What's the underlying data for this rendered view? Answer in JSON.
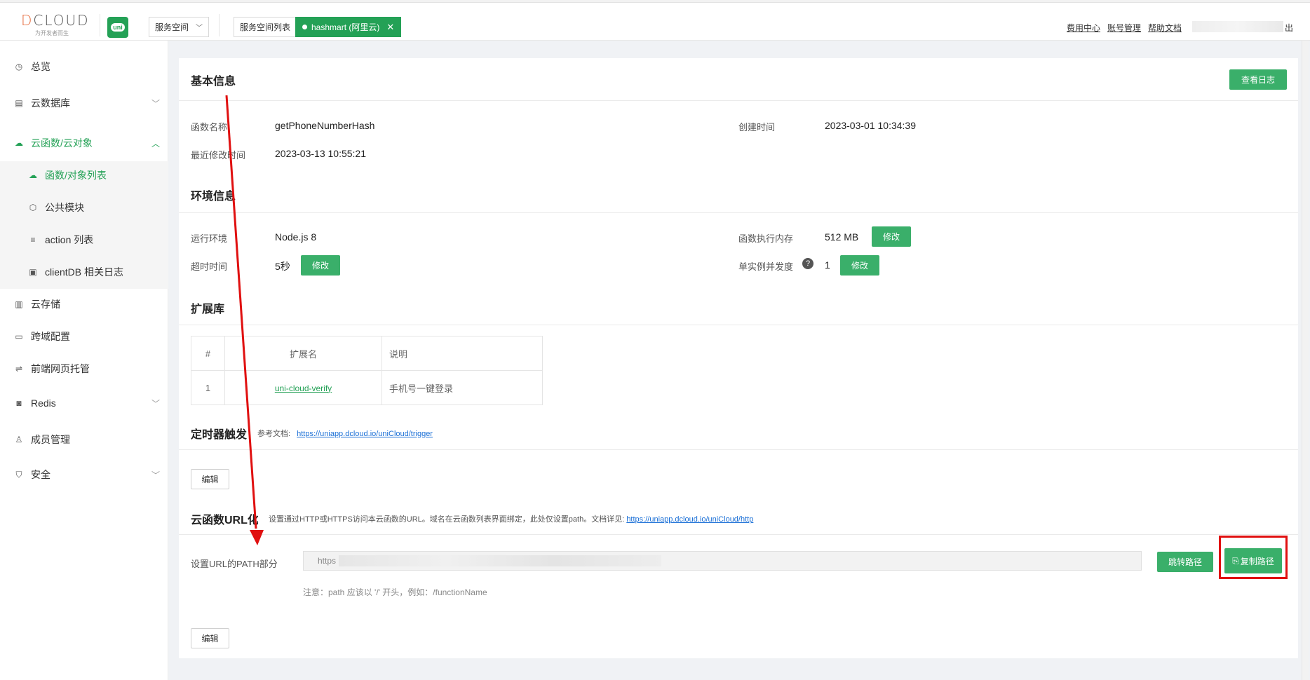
{
  "header": {
    "logo_text": "DCLOUD",
    "logo_slogan": "为开发者而生",
    "uni_badge": "uni",
    "space_dropdown": "服务空间",
    "space_list": "服务空间列表",
    "active_space": "hashmart (阿里云)",
    "links": [
      "费用中心",
      "账号管理",
      "帮助文档"
    ],
    "logout_fragment": "出"
  },
  "sidebar": {
    "items": [
      {
        "label": "总览",
        "icon": "clock-icon"
      },
      {
        "label": "云数据库",
        "icon": "database-icon"
      },
      {
        "label": "云函数/云对象",
        "icon": "cloud-icon"
      },
      {
        "label": "云存储",
        "icon": "storage-icon"
      },
      {
        "label": "跨域配置",
        "icon": "cors-icon"
      },
      {
        "label": "前端网页托管",
        "icon": "hosting-icon"
      },
      {
        "label": "Redis",
        "icon": "redis-icon"
      },
      {
        "label": "成员管理",
        "icon": "user-icon"
      },
      {
        "label": "安全",
        "icon": "shield-icon"
      }
    ],
    "subitems": [
      {
        "label": "函数/对象列表",
        "icon": "cloud-icon"
      },
      {
        "label": "公共模块",
        "icon": "cube-icon"
      },
      {
        "label": "action 列表",
        "icon": "list-icon"
      },
      {
        "label": "clientDB 相关日志",
        "icon": "log-icon"
      }
    ]
  },
  "basic": {
    "title": "基本信息",
    "view_log": "查看日志",
    "fn_name_label": "函数名称",
    "fn_name": "getPhoneNumberHash",
    "created_label": "创建时间",
    "created": "2023-03-01 10:34:39",
    "modified_label": "最近修改时间",
    "modified": "2023-03-13 10:55:21"
  },
  "env": {
    "title": "环境信息",
    "runtime_label": "运行环境",
    "runtime": "Node.js 8",
    "memory_label": "函数执行内存",
    "memory": "512 MB",
    "timeout_label": "超时时间",
    "timeout": "5秒",
    "concurrency_label": "单实例并发度",
    "concurrency": "1",
    "edit": "修改",
    "help_icon": "question-icon"
  },
  "ext": {
    "title": "扩展库",
    "headers": [
      "#",
      "扩展名",
      "说明"
    ],
    "rows": [
      [
        "1",
        "uni-cloud-verify",
        "手机号一键登录"
      ]
    ]
  },
  "trigger": {
    "title": "定时器触发",
    "ref_label": "参考文档:",
    "ref_link": "https://uniapp.dcloud.io/uniCloud/trigger",
    "edit": "编辑"
  },
  "url": {
    "title": "云函数URL化",
    "desc": "设置通过HTTP或HTTPS访问本云函数的URL。域名在云函数列表界面绑定，此处仅设置path。文档详见:",
    "doc_link": "https://uniapp.dcloud.io/uniCloud/http",
    "path_label": "设置URL的PATH部分",
    "url_prefix": "https",
    "jump": "跳转路径",
    "copy": "复制路径",
    "note": "注意：path 应该以 '/' 开头，例如：/functionName",
    "edit": "编辑"
  },
  "colors": {
    "brand_green": "#24a156",
    "button_green": "#3aaf6a",
    "annotation_red": "#e01010"
  }
}
